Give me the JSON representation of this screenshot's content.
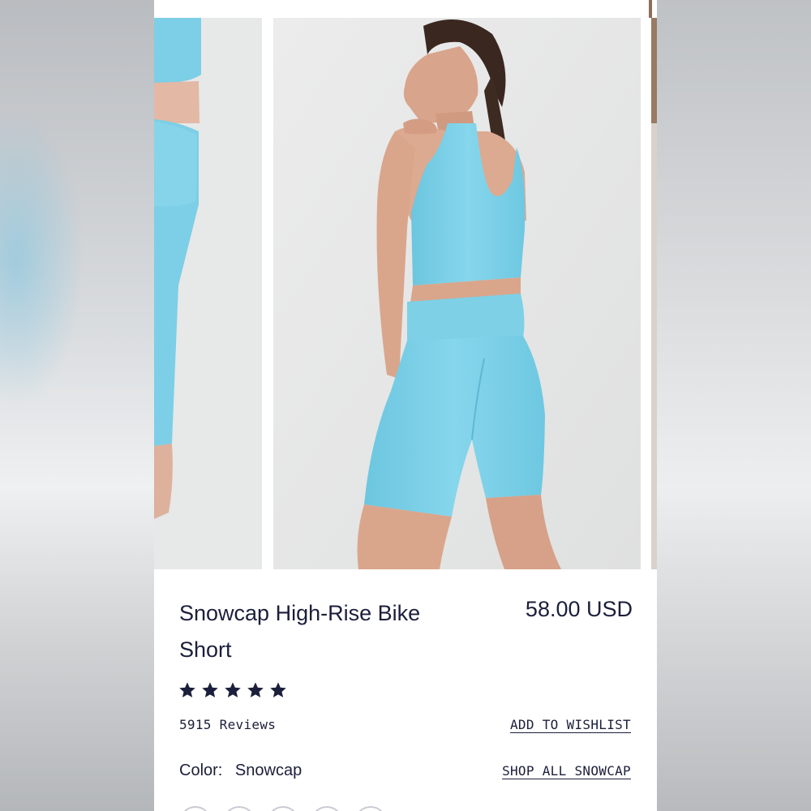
{
  "product": {
    "title": "Snowcap High-Rise Bike Short",
    "price": "58.00 USD",
    "rating": 5,
    "reviews": "5915 Reviews",
    "color_label": "Color:",
    "color_value": "Snowcap"
  },
  "actions": {
    "wishlist": "ADD TO WISHLIST",
    "shop_all": "SHOP ALL SNOWCAP"
  },
  "colors": {
    "garment": "#7ccfe6",
    "text": "#1b1f3b",
    "photo_bg": "#e9eaea"
  }
}
